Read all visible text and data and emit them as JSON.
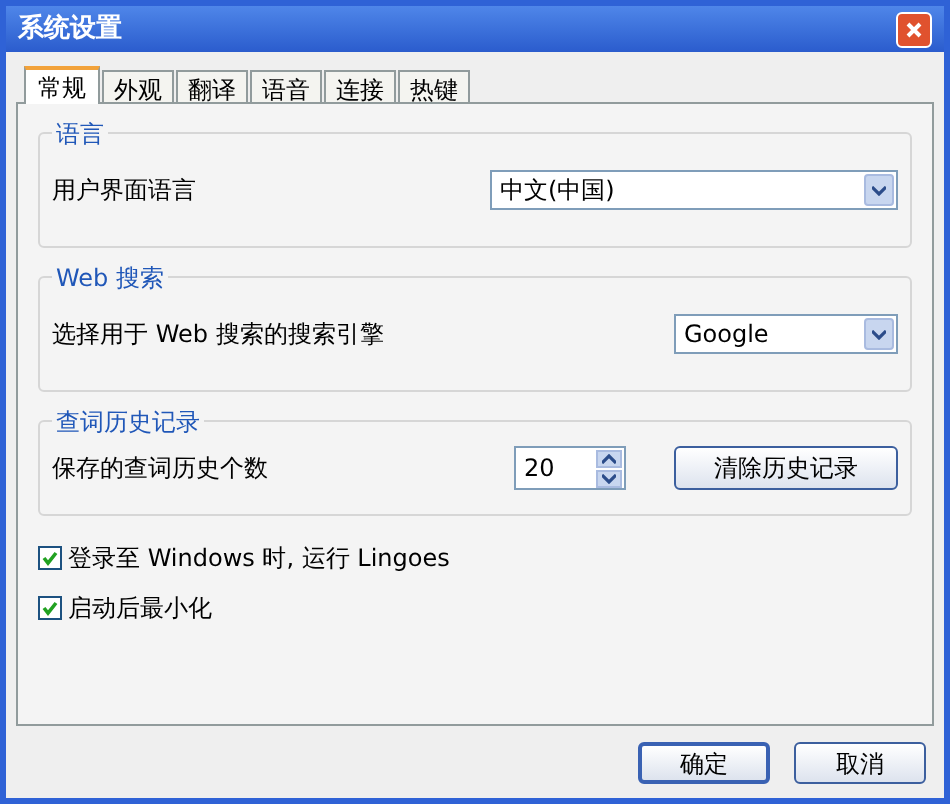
{
  "window": {
    "title": "系统设置"
  },
  "tabs": [
    {
      "label": "常规",
      "selected": true
    },
    {
      "label": "外观",
      "selected": false
    },
    {
      "label": "翻译",
      "selected": false
    },
    {
      "label": "语音",
      "selected": false
    },
    {
      "label": "连接",
      "selected": false
    },
    {
      "label": "热键",
      "selected": false
    }
  ],
  "groups": [
    {
      "title": "语言",
      "kind": "dropdown",
      "label": "用户界面语言",
      "value": "中文(中国)",
      "wide": true
    },
    {
      "title": "Web 搜索",
      "kind": "dropdown",
      "label": "选择用于 Web 搜索的搜索引擎",
      "value": "Google",
      "wide": false
    },
    {
      "title": "查词历史记录",
      "kind": "spinner",
      "label": "保存的查词历史个数",
      "value": "20",
      "button": "清除历史记录"
    }
  ],
  "checkboxes": [
    {
      "label": "登录至 Windows 时, 运行 Lingoes",
      "checked": true
    },
    {
      "label": "启动后最小化",
      "checked": true
    }
  ],
  "buttons": [
    {
      "label": "确定",
      "default": true
    },
    {
      "label": "取消",
      "default": false
    }
  ]
}
